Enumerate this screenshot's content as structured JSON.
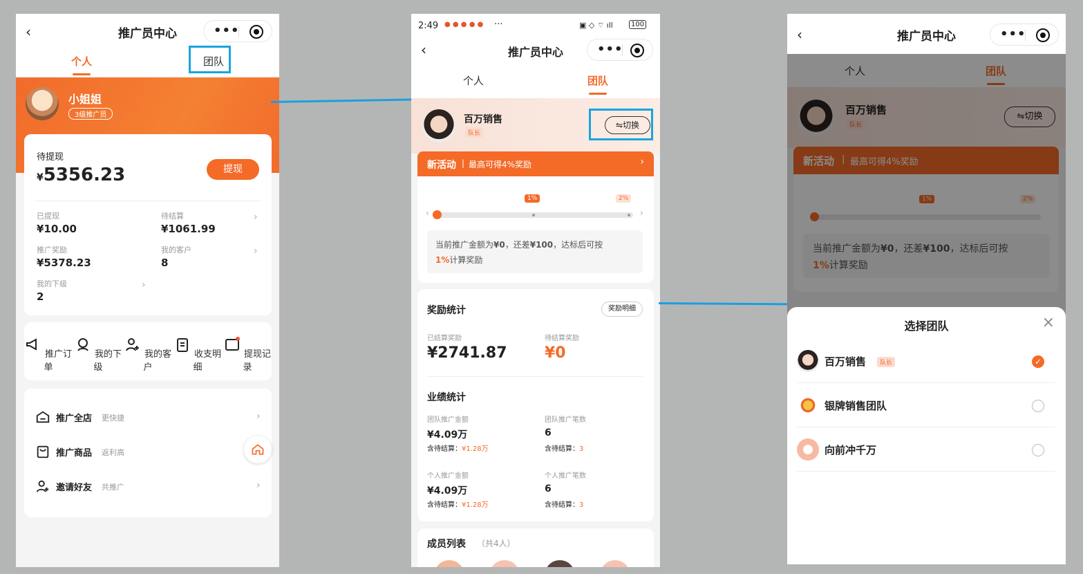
{
  "nav": {
    "title": "推广员中心"
  },
  "tabs": {
    "personal": "个人",
    "team": "团队"
  },
  "p1": {
    "user_name": "小姐姐",
    "level": "3级推广员",
    "withdraw_label": "待提现",
    "currency": "¥",
    "withdraw_amount": "5356.23",
    "withdraw_button": "提现",
    "stats": [
      {
        "label": "已提现",
        "value": "¥10.00"
      },
      {
        "label": "待结算",
        "value": "¥1061.99"
      },
      {
        "label": "推广奖励",
        "value": "¥5378.23"
      },
      {
        "label": "我的客户",
        "value": "8"
      },
      {
        "label": "我的下级",
        "value": "2"
      }
    ],
    "quick": [
      "推广订单",
      "我的下级",
      "我的客户",
      "收支明细",
      "提现记录"
    ],
    "menu": [
      {
        "label": "推广全店",
        "sub": "更快捷"
      },
      {
        "label": "推广商品",
        "sub": "返利高"
      },
      {
        "label": "邀请好友",
        "sub": "共推广"
      }
    ]
  },
  "p2": {
    "time": "2:49",
    "status_icons": "···",
    "battery": "100",
    "team_name": "百万销售",
    "role": "队长",
    "switch_button": "⇋切换",
    "activity": {
      "title": "新活动",
      "desc": "最高可得4%奖励",
      "tag1": "1%",
      "tag2": "2%"
    },
    "progress_text_1": "当前推广金额为",
    "progress_cur": "¥0",
    "progress_text_2": "，还差",
    "progress_gap": "¥100",
    "progress_text_3": "，达标后可按",
    "progress_pct": "1%",
    "progress_text_4": "计算奖励",
    "reward": {
      "title": "奖励统计",
      "detail_button": "奖励明细",
      "settled_label": "已结算奖励",
      "settled_value": "¥2741.87",
      "pending_label": "待结算奖励",
      "pending_value": "¥0"
    },
    "perf": {
      "title": "业绩统计",
      "items": [
        {
          "label": "团队推广金额",
          "value": "¥4.09万",
          "sub_label": "含待结算：",
          "sub_value": "¥1.28万"
        },
        {
          "label": "团队推广笔数",
          "value": "6",
          "sub_label": "含待结算：",
          "sub_value": "3"
        },
        {
          "label": "个人推广金额",
          "value": "¥4.09万",
          "sub_label": "含待结算：",
          "sub_value": "¥1.28万"
        },
        {
          "label": "个人推广笔数",
          "value": "6",
          "sub_label": "含待结算：",
          "sub_value": "3"
        }
      ]
    },
    "members": {
      "title": "成员列表",
      "count": "（共4人）"
    }
  },
  "p3": {
    "sheet_title": "选择团队",
    "teams": [
      {
        "name": "百万销售",
        "tag": "队长",
        "selected": true
      },
      {
        "name": "银牌销售团队",
        "tag": "",
        "selected": false
      },
      {
        "name": "向前冲千万",
        "tag": "",
        "selected": false
      }
    ]
  },
  "colors": {
    "accent": "#f46a27",
    "highlight": "#1aa3e0"
  }
}
